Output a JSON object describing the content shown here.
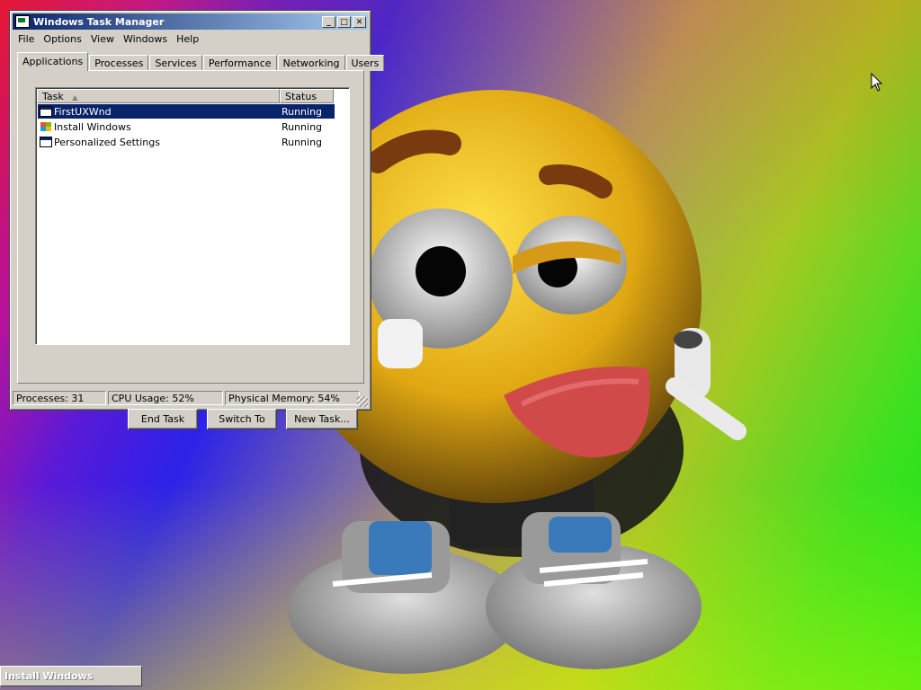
{
  "window": {
    "title": "Windows Task Manager",
    "controls": {
      "minimize": "_",
      "maximize": "□",
      "close": "✕"
    }
  },
  "menu": [
    "File",
    "Options",
    "View",
    "Windows",
    "Help"
  ],
  "tabs": [
    "Applications",
    "Processes",
    "Services",
    "Performance",
    "Networking",
    "Users"
  ],
  "active_tab": "Applications",
  "task_list": {
    "columns": {
      "task": "Task",
      "status": "Status"
    },
    "rows": [
      {
        "task": "FirstUXWnd",
        "status": "Running",
        "icon": "window-icon",
        "selected": true
      },
      {
        "task": "Install Windows",
        "status": "Running",
        "icon": "windows-logo-icon",
        "selected": false
      },
      {
        "task": "Personalized Settings",
        "status": "Running",
        "icon": "window-icon",
        "selected": false
      }
    ]
  },
  "buttons": {
    "end_task": "End Task",
    "switch_to": "Switch To",
    "new_task": "New Task..."
  },
  "statusbar": {
    "processes": "Processes: 31",
    "cpu": "CPU Usage: 52%",
    "memory": "Physical Memory: 54%"
  },
  "taskbar": {
    "install_windows": "Install Windows"
  },
  "colors": {
    "title_start": "#0a246a",
    "title_end": "#a6caf0",
    "selection": "#0a246a",
    "face": "#d4d0c8"
  }
}
